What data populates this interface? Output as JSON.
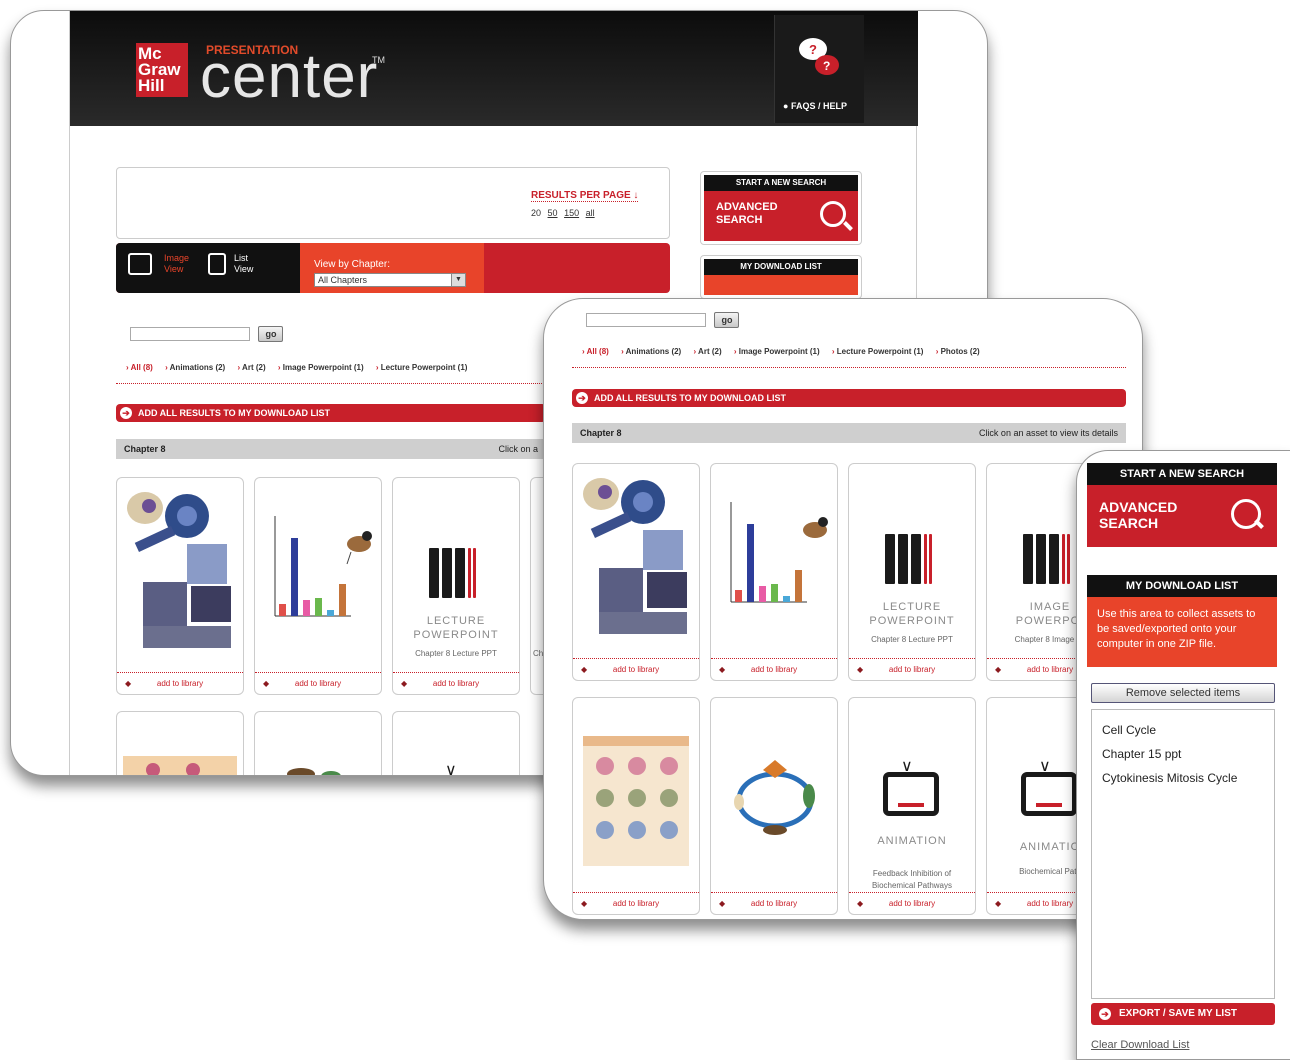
{
  "brand": {
    "logo_line1": "Mc",
    "logo_line2": "Graw",
    "logo_line3": "Hill",
    "presentation": "PRESENTATION",
    "center": "center",
    "tm": "TM"
  },
  "header": {
    "faq_label": "FAQS / HELP"
  },
  "results": {
    "label": "RESULTS PER PAGE",
    "options": [
      "20",
      "50",
      "150",
      "all"
    ]
  },
  "views": {
    "image_view": "Image View",
    "list_view": "List View",
    "by_chapter_label": "View by Chapter:",
    "chapter_selected": "All Chapters"
  },
  "search": {
    "go_label": "go",
    "new_search": "START A NEW SEARCH",
    "advanced_line1": "ADVANCED",
    "advanced_line2": "SEARCH"
  },
  "download": {
    "title": "MY DOWNLOAD LIST",
    "description": "Use this area to collect assets to be saved/exported onto your computer in one ZIP file.",
    "remove_label": "Remove selected items",
    "items": [
      "Cell Cycle",
      "Chapter 15 ppt",
      "Cytokinesis Mitosis Cycle"
    ],
    "export_label": "EXPORT / SAVE MY LIST",
    "clear_label": "Clear Download List"
  },
  "filters1": [
    "All (8)",
    "Animations (2)",
    "Art (2)",
    "Image Powerpoint (1)",
    "Lecture Powerpoint (1)"
  ],
  "filters2": [
    "All (8)",
    "Animations (2)",
    "Art (2)",
    "Image Powerpoint (1)",
    "Lecture Powerpoint (1)",
    "Photos (2)"
  ],
  "add_all_label": "ADD ALL RESULTS TO MY DOWNLOAD LIST",
  "chapter": {
    "label": "Chapter 8",
    "hint_full": "Click on an asset to view its details",
    "hint_cut": "Click on a"
  },
  "cards": {
    "add_label": "add to library",
    "lecture_type_1": "LECTURE",
    "lecture_type_2": "POWERPOINT",
    "lecture_title": "Chapter 8 Lecture PPT",
    "image_type_1": "IMAGE",
    "image_type_2": "POWERPOI",
    "image_title": "Chapter 8 Image po",
    "image_title_w1": "Ch",
    "anim_type": "ANIMATION",
    "anim_type_cut": "ANIMATIO",
    "anim_title_1": "Feedback Inhibition of",
    "anim_title_2": "Biochemical Pathways",
    "anim_title_cut": "Biochemical Path"
  },
  "colors": {
    "accent_red": "#c8202a",
    "accent_orange": "#e8442a",
    "header_black": "#111111"
  },
  "icons": [
    "faq-bubbles-icon",
    "image-view-icon",
    "list-view-icon",
    "magnifier-icon",
    "bookshelf-icon",
    "tv-icon"
  ]
}
